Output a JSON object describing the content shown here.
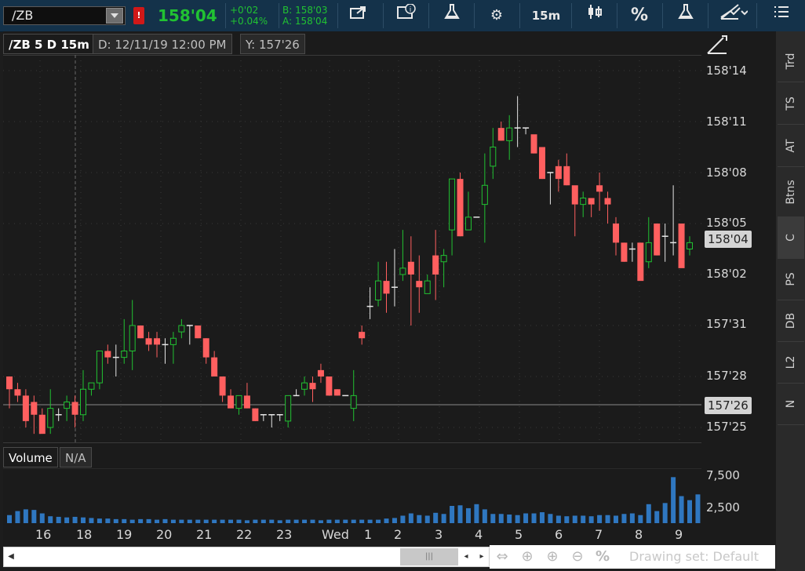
{
  "toolbar": {
    "symbol": "/ZB",
    "alert_badge": "!",
    "last_price": "158'04",
    "net_change": "+0'02",
    "net_change_pct": "+0.04%",
    "bid": "B: 158'03",
    "ask": "A: 158'04",
    "timeframe_label": "15m",
    "percent_label": "%",
    "icons": [
      "share-icon",
      "info-icon",
      "flask-icon",
      "gear-icon",
      "candle-style-icon",
      "percent-icon",
      "studies-flask-icon",
      "drawing-icon",
      "menu-icon"
    ]
  },
  "chart_header": {
    "title": "/ZB 5 D 15m",
    "date": "D: 12/11/19 12:00 PM",
    "y_value": "Y: 157'26"
  },
  "price_axis": {
    "labels": [
      "158'14",
      "158'11",
      "158'08",
      "158'05",
      "158'02",
      "157'31",
      "157'28",
      "157'25"
    ],
    "current_flag": "158'04",
    "crosshair_flag": "157'26"
  },
  "volume_pane": {
    "title": "Volume",
    "value": "N/A",
    "labels": [
      "7,500",
      "2,500"
    ]
  },
  "x_axis": {
    "labels": [
      "16",
      "18",
      "19",
      "20",
      "21",
      "22",
      "23",
      "Wed",
      "1",
      "2",
      "3",
      "4",
      "5",
      "6",
      "7",
      "8",
      "9"
    ]
  },
  "side_tabs": [
    "Trd",
    "TS",
    "AT",
    "Btns",
    "C",
    "PS",
    "DB",
    "L2",
    "N"
  ],
  "bottom_bar": {
    "drawing_set": "Drawing set: Default"
  },
  "colors": {
    "up": "#21c232",
    "down": "#ff5f5f",
    "volume": "#2f77c0",
    "toolbar_bg": "#14324a"
  },
  "chart_data": {
    "type": "candlestick",
    "candles_ohlc_32nds": [
      [
        -1,
        -1,
        -6,
        -3
      ],
      [
        -3,
        -2,
        -5,
        -4
      ],
      [
        -4,
        -3,
        -9,
        -8
      ],
      [
        -5,
        -4,
        -10,
        -7
      ],
      [
        -7,
        -6,
        -10,
        -10
      ],
      [
        -9,
        -3,
        -10,
        -6
      ],
      [
        -7,
        -6,
        -8,
        -7
      ],
      [
        -6,
        -4,
        -8,
        -5
      ],
      [
        -5,
        -4,
        -9,
        -7
      ],
      [
        -7,
        0,
        -8,
        -3
      ],
      [
        -3,
        -2,
        -4,
        -2
      ],
      [
        -2,
        2,
        -3,
        3
      ],
      [
        3,
        4,
        1,
        2
      ],
      [
        2,
        4,
        -1,
        2
      ],
      [
        2,
        8,
        1,
        3
      ],
      [
        3,
        11,
        0,
        7
      ],
      [
        7,
        7,
        5,
        5
      ],
      [
        5,
        6,
        3,
        4
      ],
      [
        5,
        6,
        2,
        4
      ],
      [
        4,
        5,
        1,
        4
      ],
      [
        4,
        6,
        1,
        5
      ],
      [
        6,
        8,
        5,
        7
      ],
      [
        7,
        7,
        4,
        7
      ],
      [
        7,
        7,
        5,
        5
      ],
      [
        5,
        5,
        1,
        2
      ],
      [
        2,
        3,
        -1,
        -1
      ],
      [
        -1,
        -1,
        -5,
        -4
      ],
      [
        -4,
        -3,
        -6,
        -6
      ],
      [
        -6,
        -4,
        -7,
        -4
      ],
      [
        -4,
        -2,
        -6,
        -6
      ],
      [
        -6,
        -6,
        -8,
        -8
      ],
      [
        -7,
        -7,
        -8,
        -7
      ],
      [
        -7,
        -7,
        -9,
        -7
      ],
      [
        -7,
        -7,
        -8,
        -7
      ],
      [
        -8,
        -4,
        -9,
        -4
      ],
      [
        -4,
        -3,
        -4,
        -4
      ],
      [
        -3,
        -1,
        -4,
        -2
      ],
      [
        -2,
        -1,
        -5,
        -3
      ],
      [
        0,
        1,
        -2,
        -1
      ],
      [
        -1,
        -1,
        -4,
        -4
      ],
      [
        -3,
        -3,
        -4,
        -4
      ],
      [
        -4,
        -4,
        -4,
        -4
      ],
      [
        -6,
        0,
        -8,
        -4
      ],
      [
        6,
        7,
        4,
        5
      ],
      [
        10,
        13,
        8,
        10
      ],
      [
        11,
        17,
        10,
        14
      ],
      [
        14,
        17,
        9,
        12
      ],
      [
        13,
        19,
        10,
        13
      ],
      [
        15,
        22,
        14,
        16
      ],
      [
        17,
        21,
        7,
        15
      ],
      [
        14,
        18,
        9,
        13
      ],
      [
        12,
        15,
        12,
        14
      ],
      [
        18,
        22,
        11,
        15
      ],
      [
        17,
        19,
        13,
        18
      ],
      [
        22,
        30,
        18,
        30
      ],
      [
        30,
        31,
        21,
        21
      ],
      [
        22,
        28,
        22,
        24
      ],
      [
        24,
        24,
        24,
        24
      ],
      [
        26,
        34,
        20,
        29
      ],
      [
        32,
        38,
        30,
        35
      ],
      [
        38,
        39,
        36,
        36
      ],
      [
        36,
        40,
        33,
        38
      ],
      [
        38,
        43,
        35,
        38
      ],
      [
        38,
        38,
        37,
        38
      ],
      [
        37,
        36,
        34,
        34
      ],
      [
        35,
        35,
        30,
        30
      ],
      [
        31,
        31,
        26,
        31
      ],
      [
        32,
        33,
        28,
        30
      ],
      [
        32,
        34,
        29,
        29
      ],
      [
        29,
        26,
        21,
        26
      ],
      [
        26,
        28,
        24,
        27
      ],
      [
        27,
        27,
        24,
        26
      ],
      [
        29,
        31,
        25,
        28
      ],
      [
        27,
        28,
        23,
        26
      ],
      [
        23,
        24,
        18,
        20
      ],
      [
        20,
        20,
        17,
        17
      ],
      [
        19,
        20,
        17,
        19
      ],
      [
        20,
        20,
        16,
        14
      ],
      [
        17,
        24,
        16,
        20
      ],
      [
        23,
        23,
        18,
        18
      ],
      [
        21,
        23,
        17,
        21
      ],
      [
        20,
        29,
        18,
        20
      ],
      [
        23,
        21,
        20,
        16
      ],
      [
        19,
        21,
        18,
        20
      ]
    ],
    "volume_values": [
      1400,
      2100,
      2400,
      2300,
      1700,
      1200,
      1100,
      1000,
      1100,
      1000,
      900,
      800,
      800,
      700,
      700,
      600,
      700,
      700,
      600,
      700,
      600,
      600,
      600,
      600,
      600,
      600,
      600,
      600,
      600,
      500,
      600,
      600,
      600,
      500,
      600,
      600,
      600,
      600,
      500,
      600,
      600,
      600,
      600,
      600,
      600,
      600,
      800,
      900,
      1300,
      1700,
      1400,
      1300,
      1800,
      1600,
      3000,
      3100,
      2600,
      3300,
      2400,
      1600,
      1600,
      1500,
      1400,
      1700,
      1700,
      1900,
      1600,
      1300,
      1200,
      1300,
      1300,
      1200,
      1400,
      1400,
      1300,
      1600,
      1700,
      1400,
      3300,
      2100,
      3500,
      8000,
      4700,
      4000,
      5000
    ],
    "ylim_32nds": [
      -9,
      47
    ],
    "volume_ylim": [
      0,
      9000
    ]
  }
}
